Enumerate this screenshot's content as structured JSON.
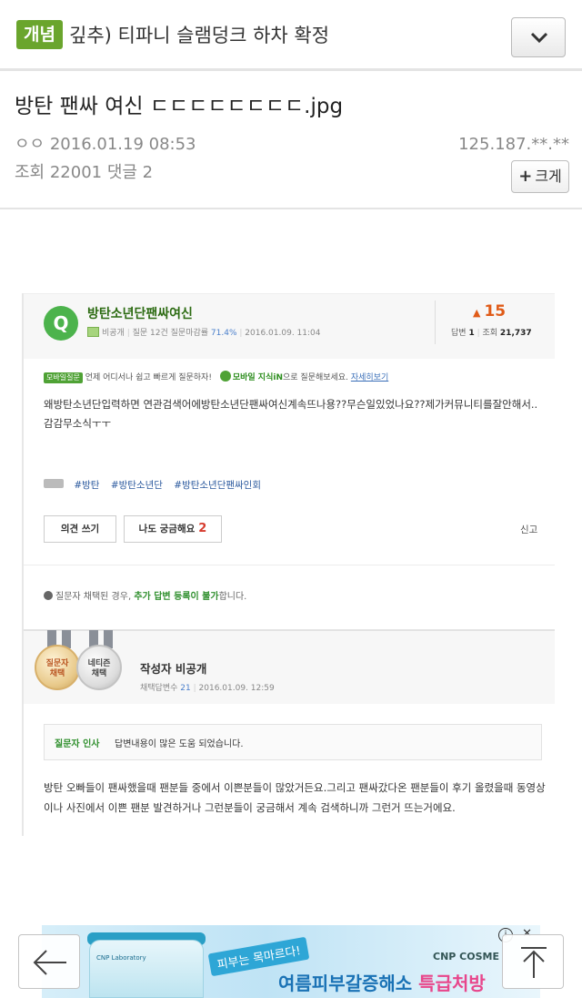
{
  "topbar": {
    "category": "개념",
    "title": "깊추) 티파니 슬램덩크 하차 확정"
  },
  "post": {
    "title": "방탄 팬싸 여신 ㄷㄷㄷㄷㄷㄷㄷㄷ.jpg",
    "author_date": "ㅇㅇ 2016.01.19 08:53",
    "ip": "125.187.**.**",
    "stats": "조회 22001 댓글 2",
    "zoom_label": "크게"
  },
  "kin": {
    "question": {
      "icon_letter": "Q",
      "title": "방탄소년단팬싸여신",
      "author": "비공개",
      "meta": "질문 12건 질문마감률",
      "close_rate": "71.4%",
      "date": "2016.01.09. 11:04",
      "score": "15",
      "answers_label": "답변",
      "answers": "1",
      "views_label": "조회",
      "views": "21,737"
    },
    "mobile": {
      "badge": "모바일질문",
      "text": "언제 어디서나 쉽고 빠르게 질문하자!",
      "app": "모바일 지식iN",
      "suffix": "으로 질문해보세요.",
      "link": "자세히보기"
    },
    "body": "왜방탄소년단입력하면 연관검색어에방탄소년단팬싸여신계속뜨나용??무슨일있었나요??제가커뮤니티를잘안해서..감감무소식ㅜㅜ",
    "tags": [
      "#방탄",
      "#방탄소년단",
      "#방탄소년단팬싸인회"
    ],
    "buttons": {
      "opinion": "의견 쓰기",
      "curious": "나도 궁금해요",
      "curious_count": "2",
      "report": "신고"
    },
    "notice": {
      "pre": "질문자 채택된 경우,",
      "highlight": "추가 답변 등록이 불가",
      "post": "합니다."
    },
    "answer": {
      "medal1": "질문자\n채택",
      "medal1_a": "질문자",
      "medal1_b": "채택",
      "medal2_a": "네티즌",
      "medal2_b": "채택",
      "title": "작성자 비공개",
      "meta_label": "채택답변수",
      "meta_count": "21",
      "date": "2016.01.09. 12:59",
      "thanks_label": "질문자 인사",
      "thanks_text": "답변내용이 많은 도움 되었습니다.",
      "body": "방탄 오빠들이 팬싸했을때 팬분들 중에서 이쁜분들이 많았거든요.그리고 팬싸갔다온 팬분들이 후기 올렸을때 동영상이나 사진에서 이쁜 팬분 발견하거나 그런분들이 궁금해서 계속 검색하니까 그런거 뜨는거에요."
    }
  },
  "ad": {
    "brand_small": "CNP Laboratory",
    "script": "피부는 목마르다!",
    "brand": "CNP COSME",
    "headline_pre": "여름피부갈증해소 ",
    "headline_hl": "특급처방",
    "info": "i",
    "close": "✕"
  },
  "icons": {
    "chevron": "chevron-down-icon",
    "back": "arrow-left-icon",
    "top": "arrow-up-icon"
  },
  "colors": {
    "category_green": "#6aa52d",
    "kin_green": "#4cb34c",
    "score_orange": "#e05b18"
  }
}
